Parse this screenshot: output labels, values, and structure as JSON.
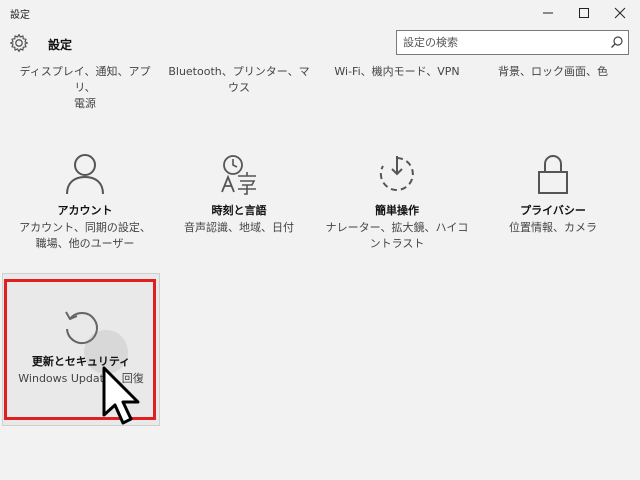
{
  "window": {
    "title": "設定"
  },
  "header": {
    "app_title": "設定"
  },
  "search": {
    "placeholder": "設定の検索"
  },
  "top_row": [
    {
      "desc_lines": [
        "ディスプレイ、通知、アプリ、",
        "電源"
      ]
    },
    {
      "desc_lines": [
        "Bluetooth、プリンター、マ",
        "ウス"
      ]
    },
    {
      "desc_lines": [
        "Wi-Fi、機内モード、VPN"
      ]
    },
    {
      "desc_lines": [
        "背景、ロック画面、色"
      ]
    }
  ],
  "categories": [
    {
      "title": "アカウント",
      "desc_lines": [
        "アカウント、同期の設定、",
        "職場、他のユーザー"
      ],
      "icon": "person-icon"
    },
    {
      "title": "時刻と言語",
      "desc_lines": [
        "音声認識、地域、日付"
      ],
      "icon": "time-language-icon"
    },
    {
      "title": "簡単操作",
      "desc_lines": [
        "ナレーター、拡大鏡、ハイコ",
        "ントラスト"
      ],
      "icon": "ease-of-access-icon"
    },
    {
      "title": "プライバシー",
      "desc_lines": [
        "位置情報、カメラ"
      ],
      "icon": "lock-icon"
    },
    {
      "title": "更新とセキュリティ",
      "desc_lines": [
        "Windows Update、回復"
      ],
      "icon": "refresh-icon"
    }
  ],
  "colors": {
    "background": "#f2f2f2",
    "highlight": "#e02020"
  }
}
